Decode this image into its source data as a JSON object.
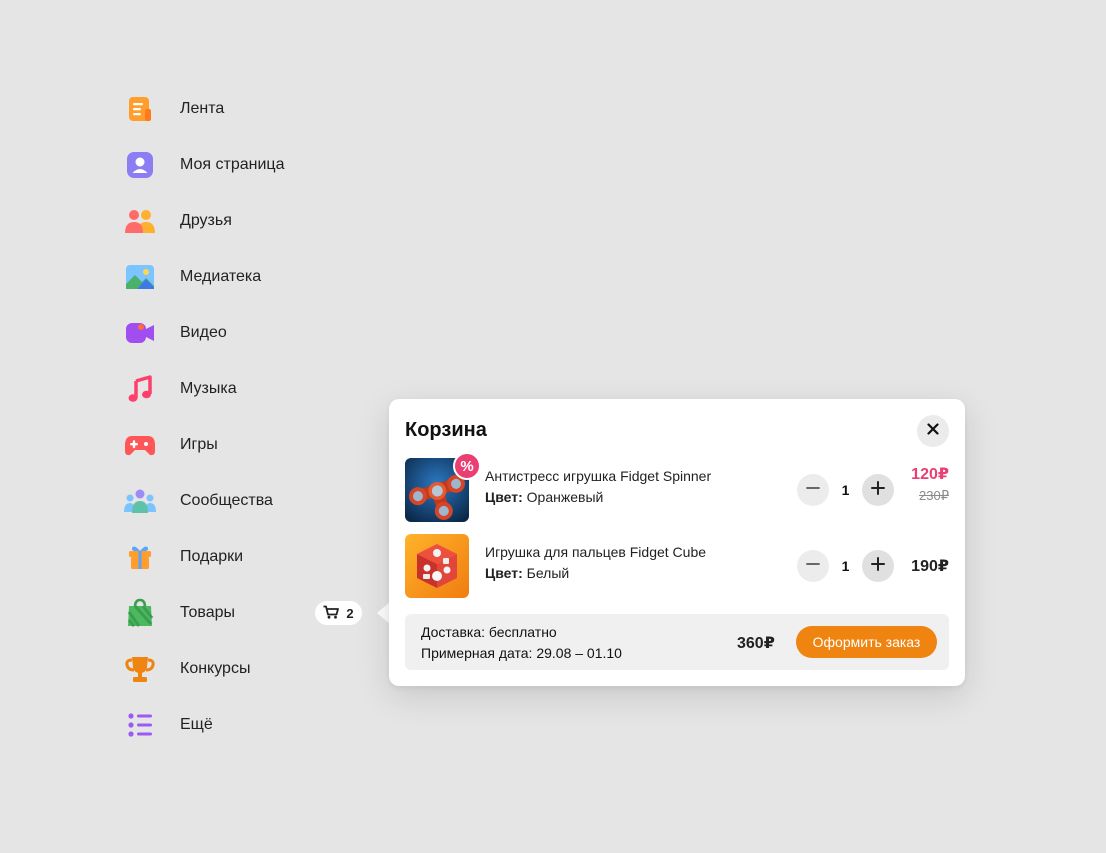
{
  "sidebar": {
    "items": [
      {
        "label": "Лента",
        "icon": "feed-icon"
      },
      {
        "label": "Моя страница",
        "icon": "profile-icon"
      },
      {
        "label": "Друзья",
        "icon": "friends-icon"
      },
      {
        "label": "Медиатека",
        "icon": "gallery-icon"
      },
      {
        "label": "Видео",
        "icon": "video-icon"
      },
      {
        "label": "Музыка",
        "icon": "music-icon"
      },
      {
        "label": "Игры",
        "icon": "gamepad-icon"
      },
      {
        "label": "Сообщества",
        "icon": "communities-icon"
      },
      {
        "label": "Подарки",
        "icon": "gift-icon"
      },
      {
        "label": "Товары",
        "icon": "shopping-bag-icon"
      },
      {
        "label": "Конкурсы",
        "icon": "trophy-icon"
      },
      {
        "label": "Ещё",
        "icon": "more-list-icon"
      }
    ]
  },
  "cart_pill": {
    "count": "2",
    "icon": "cart-icon"
  },
  "cart": {
    "title": "Корзина",
    "close_icon": "close-icon",
    "items": [
      {
        "name": "Антистресс игрушка Fidget Spinner",
        "attr_label": "Цвет:",
        "attr_value": "Оранжевый",
        "quantity": "1",
        "price": "120₽",
        "old_price": "230₽",
        "badge": "%",
        "image": "fidget-spinner-image"
      },
      {
        "name": "Игрушка для пальцев Fidget Cube",
        "attr_label": "Цвет:",
        "attr_value": "Белый",
        "quantity": "1",
        "price": "190₽",
        "image": "fidget-cube-image"
      }
    ],
    "delivery": "Доставка: бесплатно",
    "estimated_date": "Примерная дата: 29.08 – 01.10",
    "total": "360₽",
    "checkout_label": "Оформить заказ"
  },
  "colors": {
    "background": "#e5e5e5",
    "accent_orange": "#ef8410",
    "discount_pink": "#ea3f73"
  }
}
